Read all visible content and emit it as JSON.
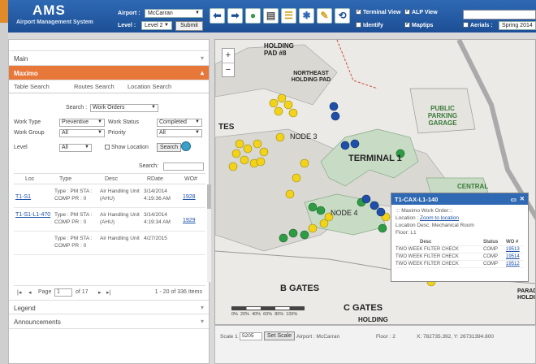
{
  "header": {
    "logo": "AMS",
    "logo_sub": "Airport Management System",
    "airport_label": "Airport :",
    "airport_value": "McCarran",
    "level_label": "Level :",
    "level_value": "Level 2",
    "submit_label": "Submit",
    "checkboxes": {
      "terminal_view": "Terminal View",
      "alp_view": "ALP View",
      "identify": "Identify",
      "maptips": "Maptips",
      "aerials": "Aerials :"
    },
    "aerials_value": "Spring 2014"
  },
  "panel": {
    "main_label": "Main",
    "maximo_label": "Maximo",
    "tabs": [
      "Table Search",
      "Routes Search",
      "Location Search"
    ],
    "search_label": "Search :",
    "search_value": "Work Orders",
    "work_type_label": "Work Type",
    "work_type_value": "Preventive",
    "work_status_label": "Work Status",
    "work_status_value": "Completed",
    "work_group_label": "Work Group",
    "work_group_value": "All",
    "priority_label": "Priority",
    "priority_value": "All",
    "level_label": "Level",
    "level_value": "All",
    "show_location_label": "Show Location",
    "search_button": "Search",
    "search_field_label": "Search:",
    "columns": [
      "Loc",
      "Type",
      "Desc",
      "RDate",
      "WO#"
    ],
    "rows": [
      {
        "loc": "T1-S1",
        "type": "Type : PM STA : COMP PR : 0",
        "desc": "Air Handling Unit (AHU)",
        "rdate": "3/14/2014 4:19:36 AM",
        "wo": "1928"
      },
      {
        "loc": "T1-S1-L1-470",
        "type": "Type : PM STA : COMP PR : 0",
        "desc": "Air Handling Unit (AHU)",
        "rdate": "3/14/2014 4:19:34 AM",
        "wo": "1929"
      },
      {
        "loc": "",
        "type": "Type : PM STA : COMP PR : 0",
        "desc": "Air Handling Unit",
        "rdate": "4/27/2015",
        "wo": ""
      }
    ],
    "pager_page_label": "Page",
    "pager_page_value": "1",
    "pager_of": "of 17",
    "pager_items": "1 - 20 of 336 Items",
    "legend_label": "Legend",
    "announcements_label": "Announcements"
  },
  "map": {
    "labels": {
      "holding_pad": "HOLDING PAD #8",
      "ne_holding": "NORTHEAST HOLDING PAD",
      "public_parking": "PUBLIC PARKING GARAGE",
      "terminal": "TERMINAL 1",
      "node3": "NODE 3",
      "node4": "NODE 4",
      "tes": "TES",
      "b_gates": "B GATES",
      "c_gates": "C GATES",
      "holding": "HOLDING",
      "central": "CENTRAL",
      "parad": "PARAD HOLDIN"
    },
    "popup": {
      "title": "T1-CAX-L1-140",
      "work_order": "::: Maximo Work Order:::",
      "location_label": "Location :",
      "location_link": "Zoom to location",
      "location_desc": "Location Desc: Mechanical Room",
      "floor": "Floor: L1",
      "columns": [
        "Desc",
        "Status",
        "WO #"
      ],
      "rows": [
        {
          "desc": "TWO WEEK FILTER CHECK",
          "status": "COMP",
          "wo": "19513"
        },
        {
          "desc": "TWO WEEK FILTER CHECK",
          "status": "COMP",
          "wo": "19514"
        },
        {
          "desc": "TWO WEEK FILTER CHECK",
          "status": "COMP",
          "wo": "19512"
        }
      ]
    },
    "scale_ticks": "0%  20%  40%  60%  80%  100%"
  },
  "footer": {
    "scale_label": "Scale 1 :",
    "scale_value": "5205",
    "set_scale": "Set Scale",
    "airport": "Airport : McCarran",
    "floor": "Floor : 2",
    "coords": "X: 782735.392, Y: 26731394.800"
  },
  "colors": {
    "header": "#2f69b4",
    "maximo": "#e8773a",
    "pin_yellow": "#f2d21a",
    "pin_green": "#2e9c44",
    "pin_blue": "#1f4fa8"
  }
}
